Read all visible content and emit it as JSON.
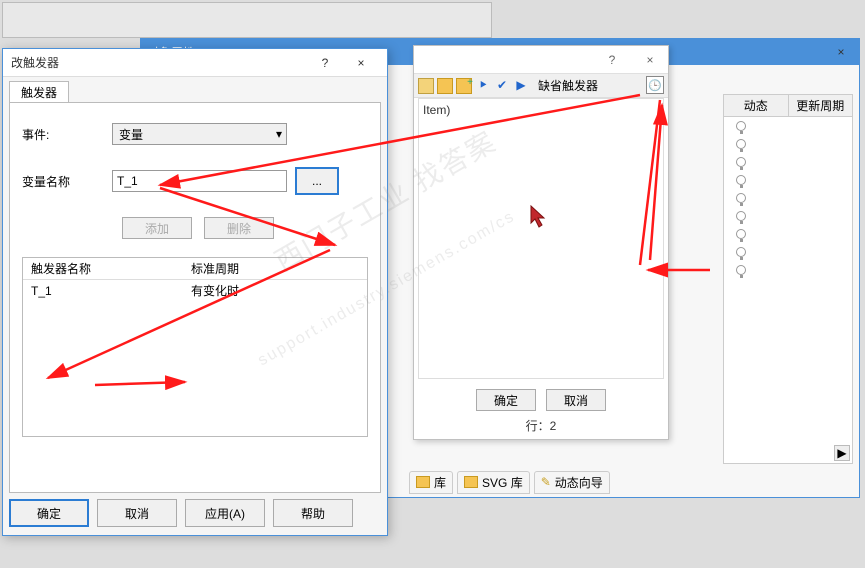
{
  "bg_window": {
    "title": "对象属性",
    "bottom_tabs": [
      "库",
      "SVG 库",
      "动态向导"
    ]
  },
  "inner_dialog": {
    "help_icon": "?",
    "close_icon": "×",
    "default_trigger_label": "缺省触发器",
    "content_line": "Item)",
    "ok": "确定",
    "cancel": "取消",
    "status": "行：2"
  },
  "right_panel": {
    "col1": "动态",
    "col2": "更新周期",
    "bulb_count": 9
  },
  "trigger_dialog": {
    "title": "改触发器",
    "sys_help": "?",
    "sys_close": "×",
    "tab": "触发器",
    "event_label": "事件:",
    "event_value": "变量",
    "varname_label": "变量名称",
    "varname_value": "T_1",
    "browse_label": "...",
    "add_label": "添加",
    "delete_label": "删除",
    "col_trigger_name": "触发器名称",
    "col_std_cycle": "标准周期",
    "row_name": "T_1",
    "row_cycle": "有变化时",
    "ok": "确定",
    "cancel": "取消",
    "apply": "应用(A)",
    "help": "帮助"
  },
  "watermark": {
    "line1": "西门子工业 找答案",
    "line2": "support.industry.siemens.com/cs"
  }
}
